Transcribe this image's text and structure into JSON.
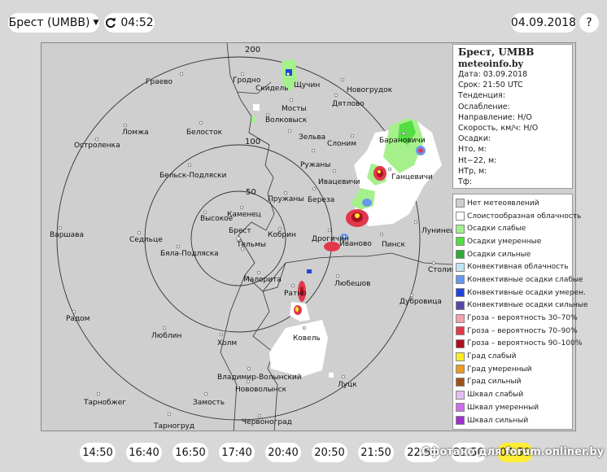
{
  "header": {
    "station_label": "Брест (UMBB)",
    "time_label": "04:52",
    "date_label": "04.09.2018",
    "help_label": "?"
  },
  "map": {
    "ring_labels": [
      "200",
      "100",
      "50"
    ],
    "cities": [
      "Гродно",
      "Скидель",
      "Щучин",
      "Новогрудок",
      "Граево",
      "Мосты",
      "Дятлово",
      "Волковыск",
      "Ломжа",
      "Белосток",
      "Зельва",
      "Слоним",
      "Барановичи",
      "Остроленка",
      "Ружаны",
      "Ивацевичи",
      "Ганцевичи",
      "Бельск-Подляски",
      "Пружаны",
      "Береза",
      "Высокое",
      "Каменец",
      "Брест",
      "Кобрин",
      "Тельмы",
      "Дрогичин",
      "Иваново",
      "Пинск",
      "Лунинец",
      "Варшава",
      "Седльце",
      "Бяла-Подляска",
      "Столин",
      "Малорита",
      "Любешов",
      "Ратно",
      "Дубровица",
      "Радом",
      "Люблин",
      "Ковель",
      "Холм",
      "Владимир-Волынский",
      "Нововолынск",
      "Луцк",
      "Тарнобжег",
      "Замость",
      "Тарногруд",
      "Червоноград"
    ]
  },
  "info": {
    "title": "Брест, UMBB",
    "site": "meteoinfo.by",
    "lines": [
      "Дата: 03.09.2018",
      "Срок: 21:50 UTC",
      "Тенденция:",
      "Ослабление:",
      "Направление: Н/О",
      "Скорость, км/ч: Н/О",
      "Осадки:",
      "Hто, м:",
      "Ht−22, м:",
      "HТр, м:",
      "Тф:"
    ]
  },
  "legend": [
    {
      "label": "Нет метеоявлений",
      "color": "#cfcfcf"
    },
    {
      "label": "Слоистообразная облачность",
      "color": "#ffffff"
    },
    {
      "label": "Осадки слабые",
      "color": "#a6f08c"
    },
    {
      "label": "Осадки умеренные",
      "color": "#55dd44"
    },
    {
      "label": "Осадки сильные",
      "color": "#2faa3a"
    },
    {
      "label": "Конвективная облачность",
      "color": "#bfe6f6"
    },
    {
      "label": "Конвективные осадки слабые",
      "color": "#6699ee"
    },
    {
      "label": "Конвективные осадки умерен.",
      "color": "#2244dd"
    },
    {
      "label": "Конвективные осадки сильные",
      "color": "#5a45aa"
    },
    {
      "label": "Гроза – вероятность 30–70%",
      "color": "#f2a3b0"
    },
    {
      "label": "Гроза – вероятность 70–90%",
      "color": "#e2384c"
    },
    {
      "label": "Гроза – вероятность 90–100%",
      "color": "#aa1020"
    },
    {
      "label": "Град слабый",
      "color": "#ffee22"
    },
    {
      "label": "Град умеренный",
      "color": "#ee9922"
    },
    {
      "label": "Град сильный",
      "color": "#a0521d"
    },
    {
      "label": "Шквал слабый",
      "color": "#e6bdf2"
    },
    {
      "label": "Шквал умеренный",
      "color": "#cc6ee6"
    },
    {
      "label": "Шквал сильный",
      "color": "#9b2fcf"
    }
  ],
  "timeline": [
    "14:50",
    "16:40",
    "16:50",
    "17:40",
    "20:40",
    "20:50",
    "21:50",
    "22:50",
    "23:50",
    "04:50"
  ],
  "timeline_active_index": 9,
  "watermark": "Сфотано для forum.onliner.by"
}
